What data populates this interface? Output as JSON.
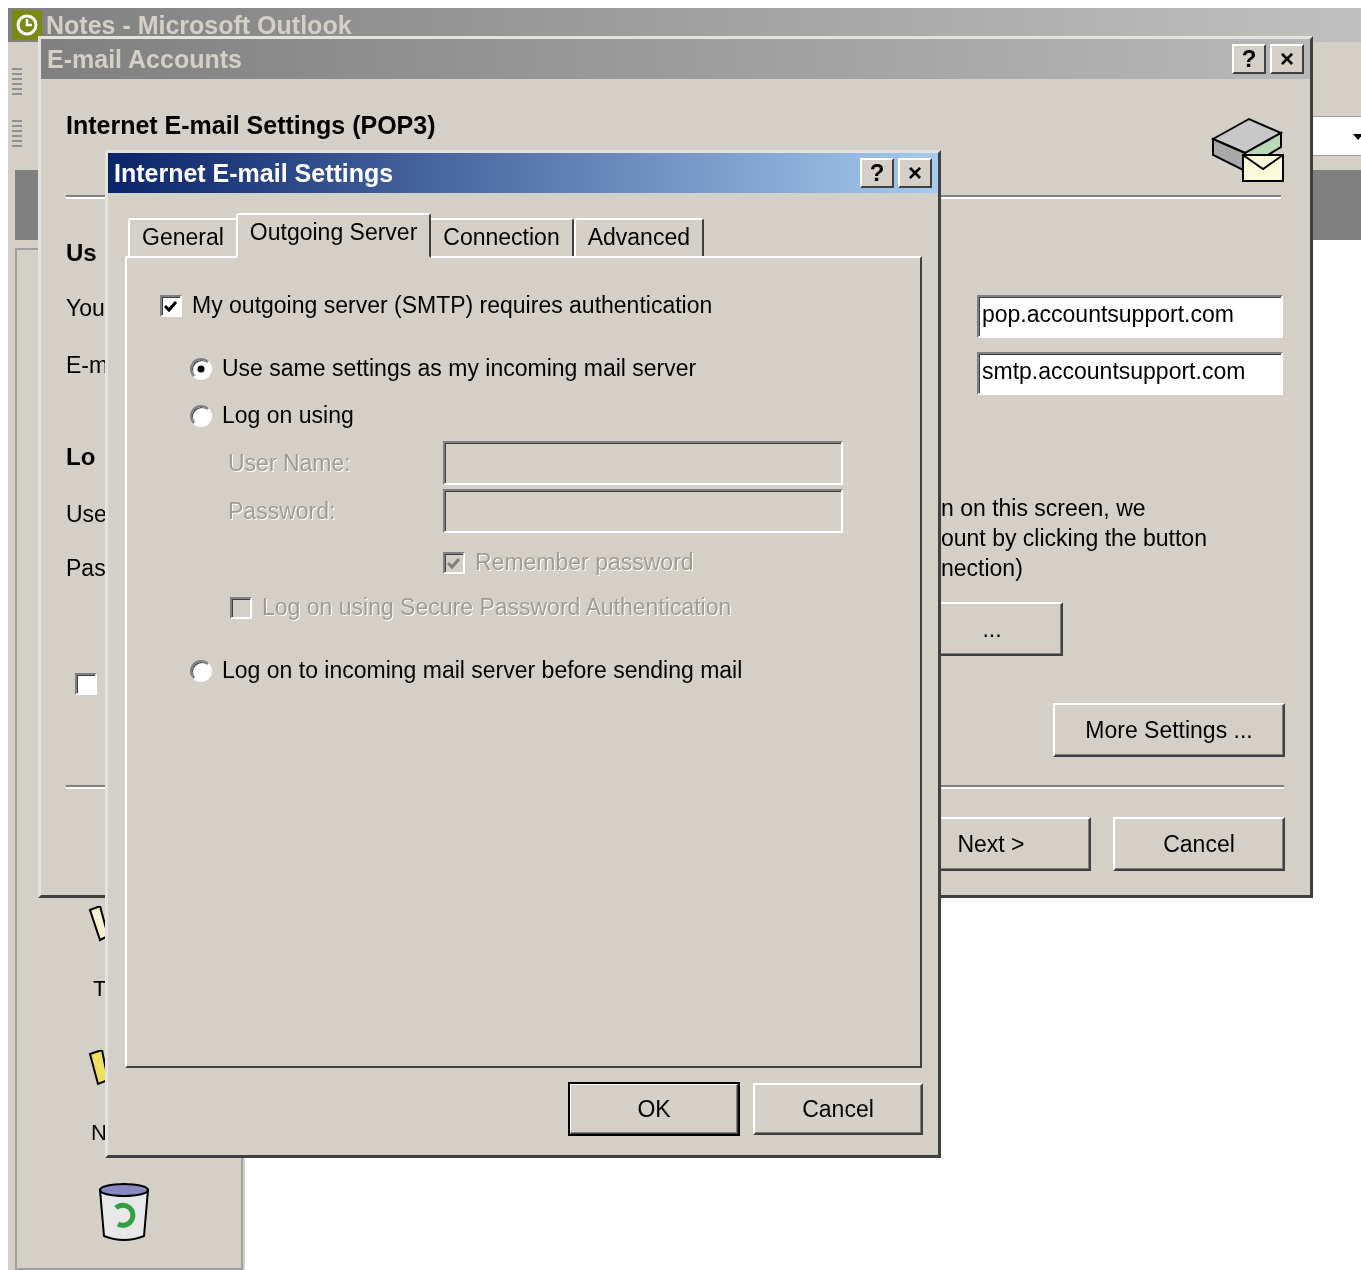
{
  "outlook": {
    "title": "Notes - Microsoft Outlook",
    "nav_labels": [
      "T",
      "N"
    ]
  },
  "accounts": {
    "title": "E-mail Accounts",
    "title_buttons": [
      "?",
      "×"
    ],
    "heading": "Internet E-mail Settings (POP3)",
    "left_labels": [
      {
        "text": "Us",
        "kind": "section"
      },
      {
        "text": "You",
        "kind": "field"
      },
      {
        "text": "E-m",
        "kind": "field"
      },
      {
        "text": "Lo",
        "kind": "section"
      },
      {
        "text": "Use",
        "kind": "field"
      },
      {
        "text": "Pas",
        "kind": "field"
      }
    ],
    "server_fields": [
      "pop.accountsupport.com",
      "smtp.accountsupport.com"
    ],
    "note_lines": [
      "n on this screen, we",
      "ount by clicking the button",
      "nection)"
    ],
    "option_checkbox": {
      "checked": false
    },
    "test_button": {
      "label": "..."
    },
    "more_settings": {
      "label": "More Settings ..."
    },
    "footer_buttons": [
      {
        "label": "Next >"
      },
      {
        "label": "Cancel"
      }
    ]
  },
  "settings": {
    "title": "Internet E-mail Settings",
    "title_buttons": [
      "?",
      "×"
    ],
    "tabs": [
      {
        "label": "General",
        "selected": false
      },
      {
        "label": "Outgoing Server",
        "selected": true
      },
      {
        "label": "Connection",
        "selected": false
      },
      {
        "label": "Advanced",
        "selected": false
      }
    ],
    "auth": {
      "label": "My outgoing server (SMTP) requires authentication",
      "checked": true
    },
    "radios": [
      {
        "label": "Use same settings as my incoming mail server",
        "selected": true
      },
      {
        "label": "Log on using",
        "selected": false
      },
      {
        "label": "Log on to incoming mail server before sending mail",
        "selected": false
      }
    ],
    "user_name": {
      "label": "User Name:",
      "disabled": true
    },
    "password": {
      "label": "Password:",
      "disabled": true
    },
    "remember": {
      "label": "Remember password",
      "checked": true,
      "disabled": true
    },
    "spa": {
      "label": "Log on using Secure Password Authentication",
      "checked": false,
      "disabled": true
    },
    "buttons": [
      {
        "label": "OK",
        "default": true
      },
      {
        "label": "Cancel",
        "default": false
      }
    ]
  }
}
